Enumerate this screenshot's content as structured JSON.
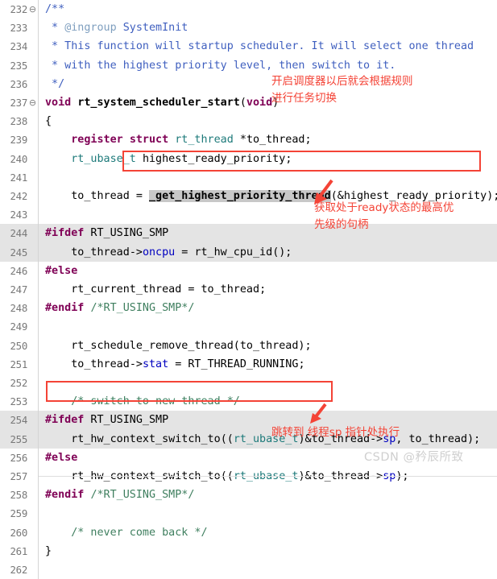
{
  "editor": {
    "first_line_number": 232,
    "colors": {
      "keyword": "#7f0055",
      "comment": "#3f7f5f",
      "javadoc": "#3f5fbf",
      "type": "#1d7a7a",
      "field": "#0000c0",
      "selection": "#c8c8c8",
      "inactive_block": "#e4e4e4",
      "annotation": "#f44336",
      "gutter_text": "#787878",
      "background": "#ffffff"
    },
    "lines": [
      {
        "num": "232",
        "fold": "⊖",
        "code": "/**",
        "inactive": false
      },
      {
        "num": "233",
        "fold": "",
        "code": " * @ingroup SystemInit",
        "inactive": false
      },
      {
        "num": "234",
        "fold": "",
        "code": " * This function will startup scheduler. It will select one thread",
        "inactive": false
      },
      {
        "num": "235",
        "fold": "",
        "code": " * with the highest priority level, then switch to it.",
        "inactive": false
      },
      {
        "num": "236",
        "fold": "",
        "code": " */",
        "inactive": false
      },
      {
        "num": "237",
        "fold": "⊖",
        "code": "void rt_system_scheduler_start(void)",
        "inactive": false
      },
      {
        "num": "238",
        "fold": "",
        "code": "{",
        "inactive": false
      },
      {
        "num": "239",
        "fold": "",
        "code": "    register struct rt_thread *to_thread;",
        "inactive": false
      },
      {
        "num": "240",
        "fold": "",
        "code": "    rt_ubase_t highest_ready_priority;",
        "inactive": false
      },
      {
        "num": "241",
        "fold": "",
        "code": "",
        "inactive": false
      },
      {
        "num": "242",
        "fold": "",
        "code": "    to_thread = _get_highest_priority_thread(&highest_ready_priority);",
        "inactive": false
      },
      {
        "num": "243",
        "fold": "",
        "code": "",
        "inactive": false
      },
      {
        "num": "244",
        "fold": "",
        "code": "#ifdef RT_USING_SMP",
        "inactive": true
      },
      {
        "num": "245",
        "fold": "",
        "code": "    to_thread->oncpu = rt_hw_cpu_id();",
        "inactive": true
      },
      {
        "num": "246",
        "fold": "",
        "code": "#else",
        "inactive": false
      },
      {
        "num": "247",
        "fold": "",
        "code": "    rt_current_thread = to_thread;",
        "inactive": false
      },
      {
        "num": "248",
        "fold": "",
        "code": "#endif /*RT_USING_SMP*/",
        "inactive": false
      },
      {
        "num": "249",
        "fold": "",
        "code": "",
        "inactive": false
      },
      {
        "num": "250",
        "fold": "",
        "code": "    rt_schedule_remove_thread(to_thread);",
        "inactive": false
      },
      {
        "num": "251",
        "fold": "",
        "code": "    to_thread->stat = RT_THREAD_RUNNING;",
        "inactive": false
      },
      {
        "num": "252",
        "fold": "",
        "code": "",
        "inactive": false
      },
      {
        "num": "253",
        "fold": "",
        "code": "    /* switch to new thread */",
        "inactive": false
      },
      {
        "num": "254",
        "fold": "",
        "code": "#ifdef RT_USING_SMP",
        "inactive": true
      },
      {
        "num": "255",
        "fold": "",
        "code": "    rt_hw_context_switch_to((rt_ubase_t)&to_thread->sp, to_thread);",
        "inactive": true
      },
      {
        "num": "256",
        "fold": "",
        "code": "#else",
        "inactive": false
      },
      {
        "num": "257",
        "fold": "",
        "code": "    rt_hw_context_switch_to((rt_ubase_t)&to_thread->sp);",
        "inactive": false
      },
      {
        "num": "258",
        "fold": "",
        "code": "#endif /*RT_USING_SMP*/",
        "inactive": false
      },
      {
        "num": "259",
        "fold": "",
        "code": "",
        "inactive": false
      },
      {
        "num": "260",
        "fold": "",
        "code": "    /* never come back */",
        "inactive": false
      },
      {
        "num": "261",
        "fold": "",
        "code": "}",
        "inactive": false
      },
      {
        "num": "262",
        "fold": "",
        "code": "",
        "inactive": false
      }
    ]
  },
  "annotations": [
    {
      "id": "scheduler-note",
      "line1": "开启调度器以后就会根据规则",
      "line2": "进行任务切换"
    },
    {
      "id": "ready-note",
      "line1": "获取处于ready状态的最高优",
      "line2": "先级的句柄"
    },
    {
      "id": "jump-note",
      "line1": "跳转到 线程sp 指针处执行",
      "line2": ""
    }
  ],
  "watermark": {
    "text": "CSDN @矜辰所致"
  }
}
